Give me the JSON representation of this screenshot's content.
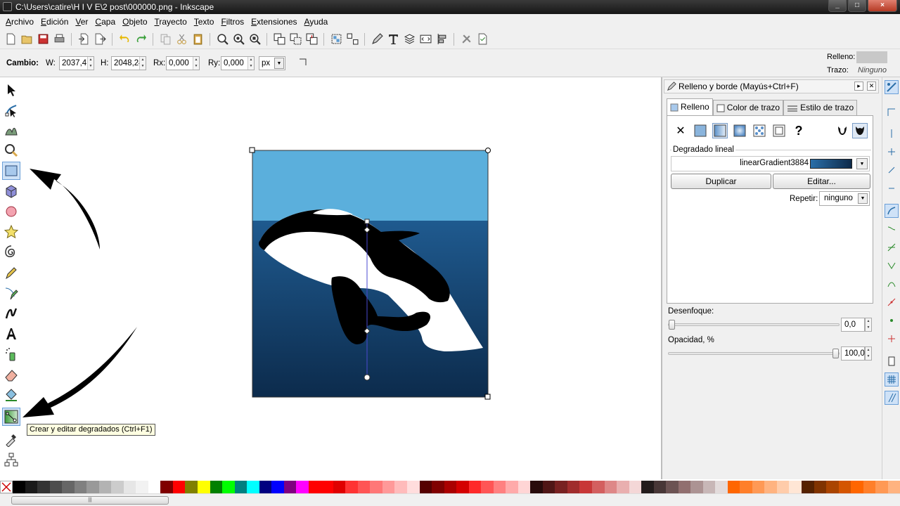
{
  "window": {
    "title": "C:\\Users\\catire\\H I V E\\2 post\\000000.png - Inkscape"
  },
  "menu": [
    "Archivo",
    "Edición",
    "Ver",
    "Capa",
    "Objeto",
    "Trayecto",
    "Texto",
    "Filtros",
    "Extensiones",
    "Ayuda"
  ],
  "toolcontrols": {
    "cambio_label": "Cambio:",
    "w_label": "W:",
    "w_value": "2037,41",
    "h_label": "H:",
    "h_value": "2048,24",
    "rx_label": "Rx:",
    "rx_value": "0,000",
    "ry_label": "Ry:",
    "ry_value": "0,000",
    "unit": "px"
  },
  "style_indicator": {
    "fill_label": "Relleno:",
    "stroke_label": "Trazo:",
    "stroke_value": "Ninguno",
    "fill_color": "#c8c8c8"
  },
  "tooltip": "Crear y editar degradados (Ctrl+F1)",
  "dialog": {
    "title": "Relleno y borde (Mayús+Ctrl+F)",
    "tabs": [
      "Relleno",
      "Color de trazo",
      "Estilo de trazo"
    ],
    "gradient_section_label": "Degradado lineal",
    "gradient_name": "linearGradient3884",
    "duplicate_button": "Duplicar",
    "edit_button": "Editar...",
    "repeat_label": "Repetir:",
    "repeat_value": "ninguno",
    "blur_label": "Desenfoque:",
    "blur_value": "0,0",
    "blur_fraction": 0.0,
    "opacity_label": "Opacidad, %",
    "opacity_value": "100,0",
    "opacity_fraction": 1.0
  },
  "colors": {
    "sky": "#5bafdc",
    "sea_top": "#1f5a8f",
    "sea_bottom": "#0c2b4c",
    "accent": "#6a9fd8"
  },
  "palette": [
    "#000000",
    "#1a1a1a",
    "#333333",
    "#4d4d4d",
    "#666666",
    "#808080",
    "#999999",
    "#b3b3b3",
    "#cccccc",
    "#e6e6e6",
    "#f2f2f2",
    "#ffffff",
    "#800000",
    "#ff0000",
    "#808000",
    "#ffff00",
    "#008000",
    "#00ff00",
    "#008080",
    "#00ffff",
    "#000080",
    "#0000ff",
    "#800080",
    "#ff00ff",
    "#ff0000",
    "#ff0000",
    "#e00000",
    "#ff3333",
    "#ff5555",
    "#ff7777",
    "#ff9999",
    "#ffbbbb",
    "#ffdddd",
    "#550000",
    "#800000",
    "#aa0000",
    "#d40000",
    "#ff2a2a",
    "#ff5555",
    "#ff8080",
    "#ffaaaa",
    "#ffd5d5",
    "#280b0b",
    "#501616",
    "#782121",
    "#a02c2c",
    "#c83737",
    "#d35f5f",
    "#de8787",
    "#e9afaf",
    "#f4d7d7",
    "#241c1c",
    "#483737",
    "#6c5353",
    "#916f6f",
    "#ac9393",
    "#c8b7b7",
    "#e3dbdb",
    "#ff6600",
    "#ff7f2a",
    "#ff9955",
    "#ffb380",
    "#ffccaa",
    "#ffe6d5",
    "#552200",
    "#803300",
    "#aa4400",
    "#d45500",
    "#ff6600",
    "#ff7f2a",
    "#ff9955",
    "#ffb380"
  ]
}
